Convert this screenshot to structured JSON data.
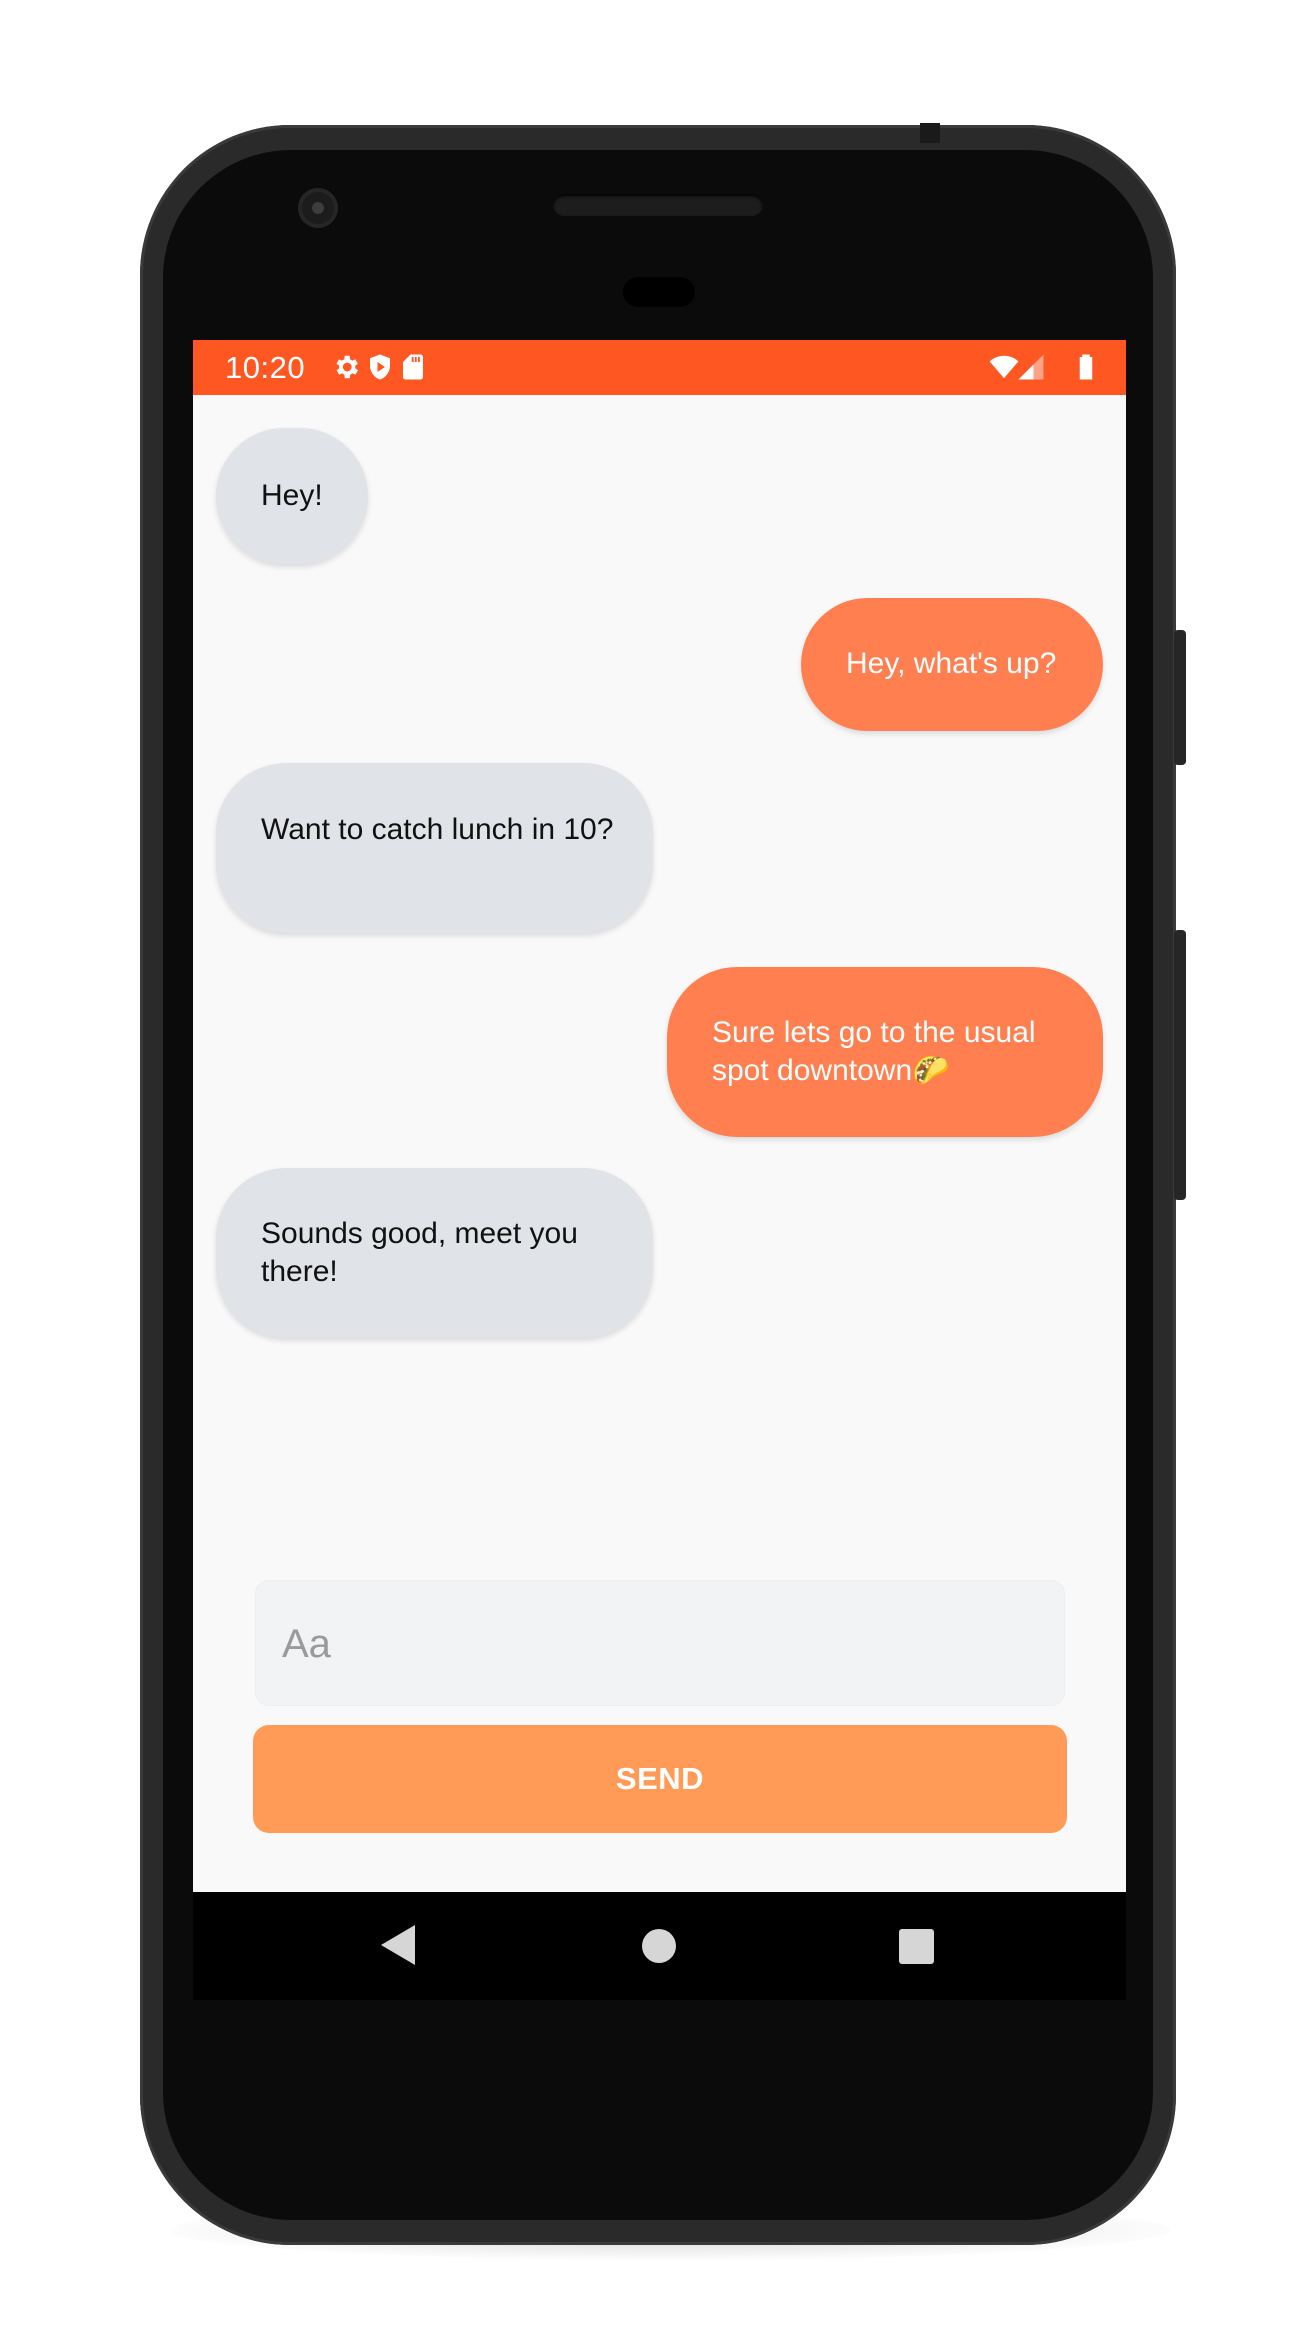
{
  "status_bar": {
    "time": "10:20",
    "background": "#ff5722",
    "left_icons": [
      "settings-icon",
      "shield-play-icon",
      "sd-card-icon"
    ],
    "right_icons": [
      "wifi-icon",
      "cell-signal-icon",
      "battery-icon"
    ]
  },
  "messages": [
    {
      "direction": "incoming",
      "text": "Hey!"
    },
    {
      "direction": "outgoing",
      "text": "Hey, what's up?"
    },
    {
      "direction": "incoming",
      "text": "Want to catch lunch in 10?"
    },
    {
      "direction": "outgoing",
      "text": "Sure lets go to the usual spot downtown🌮"
    },
    {
      "direction": "incoming",
      "text": "Sounds good, meet you there!"
    }
  ],
  "composer": {
    "placeholder": "Aa",
    "send_label": "SEND"
  },
  "nav_bar": {
    "buttons": [
      "back-icon",
      "home-icon",
      "recents-icon"
    ]
  },
  "colors": {
    "accent": "#ff5722",
    "outgoing_bubble": "#ff7f50",
    "incoming_bubble": "#e0e3e7",
    "send_button": "#ff9b56"
  }
}
